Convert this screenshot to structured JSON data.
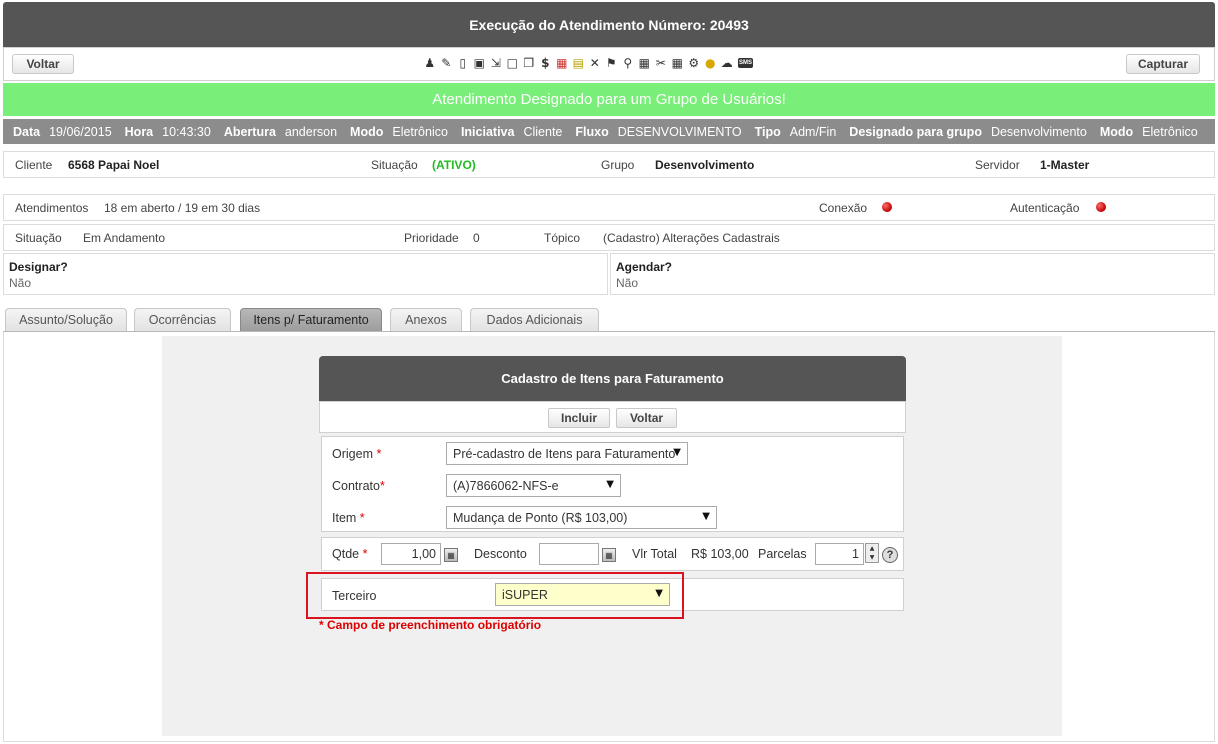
{
  "header": {
    "title": "Execução do Atendimento Número: 20493"
  },
  "toolbar": {
    "back_label": "Voltar",
    "capture_label": "Capturar",
    "icons": [
      "users-icon",
      "user-edit-icon",
      "phone-icon",
      "contact-card-icon",
      "export-icon",
      "window-icon",
      "documents-icon",
      "dollar-icon",
      "calendar-icon",
      "notes-icon",
      "tools-icon",
      "map-icon",
      "search-doc-icon",
      "table-icon",
      "scissors-icon",
      "doc-settings-icon",
      "gear-icon",
      "lightbulb-icon",
      "network-icon",
      "sms-icon"
    ],
    "sms_text": "SMS"
  },
  "banner": {
    "text": "Atendimento Designado para um Grupo de Usuários!"
  },
  "infobar": [
    {
      "label": "Data",
      "value": "19/06/2015"
    },
    {
      "label": "Hora",
      "value": "10:43:30"
    },
    {
      "label": "Abertura",
      "value": "anderson"
    },
    {
      "label": "Modo",
      "value": "Eletrônico"
    },
    {
      "label": "Iniciativa",
      "value": "Cliente"
    },
    {
      "label": "Fluxo",
      "value": "DESENVOLVIMENTO"
    },
    {
      "label": "Tipo",
      "value": "Adm/Fin"
    },
    {
      "label": "Designado para grupo",
      "value": "Desenvolvimento"
    },
    {
      "label": "Modo",
      "value": "Eletrônico"
    }
  ],
  "client_row": {
    "cliente_label": "Cliente",
    "cliente_value": "6568 Papai Noel",
    "situacao_label": "Situação",
    "situacao_value": "(ATIVO)",
    "grupo_label": "Grupo",
    "grupo_value": "Desenvolvimento",
    "servidor_label": "Servidor",
    "servidor_value": "1-Master",
    "status_color": "#22bb22"
  },
  "atend_row": {
    "atend_label": "Atendimentos",
    "atend_value": "18 em aberto / 19 em 30 dias",
    "conexao_label": "Conexão",
    "autent_label": "Autenticação"
  },
  "status_row": {
    "situacao_label": "Situação",
    "situacao_value": "Em Andamento",
    "prioridade_label": "Prioridade",
    "prioridade_value": "0",
    "topico_label": "Tópico",
    "topico_value": "(Cadastro) Alterações Cadastrais"
  },
  "designar": {
    "title": "Designar?",
    "value": "Não"
  },
  "agendar": {
    "title": "Agendar?",
    "value": "Não"
  },
  "tabs": [
    "Assunto/Solução",
    "Ocorrências",
    "Itens p/ Faturamento",
    "Anexos",
    "Dados Adicionais"
  ],
  "active_tab": "Itens p/ Faturamento",
  "form": {
    "title": "Cadastro de Itens para Faturamento",
    "incluir_label": "Incluir",
    "voltar_label": "Voltar",
    "origem_label": "Origem",
    "origem_value": "Pré-cadastro de Itens para Faturamento",
    "contrato_label": "Contrato",
    "contrato_value": "(A)7866062-NFS-e",
    "item_label": "Item",
    "item_value": "Mudança de Ponto (R$ 103,00)",
    "qtde_label": "Qtde",
    "qtde_value": "1,00",
    "desconto_label": "Desconto",
    "desconto_value": "",
    "vlrtotal_label": "Vlr Total",
    "vlrtotal_value": "R$ 103,00",
    "parcelas_label": "Parcelas",
    "parcelas_value": "1",
    "terceiro_label": "Terceiro",
    "terceiro_value": "iSUPER",
    "required_mark": "*",
    "required_note": "* Campo de preenchimento obrigatório"
  }
}
